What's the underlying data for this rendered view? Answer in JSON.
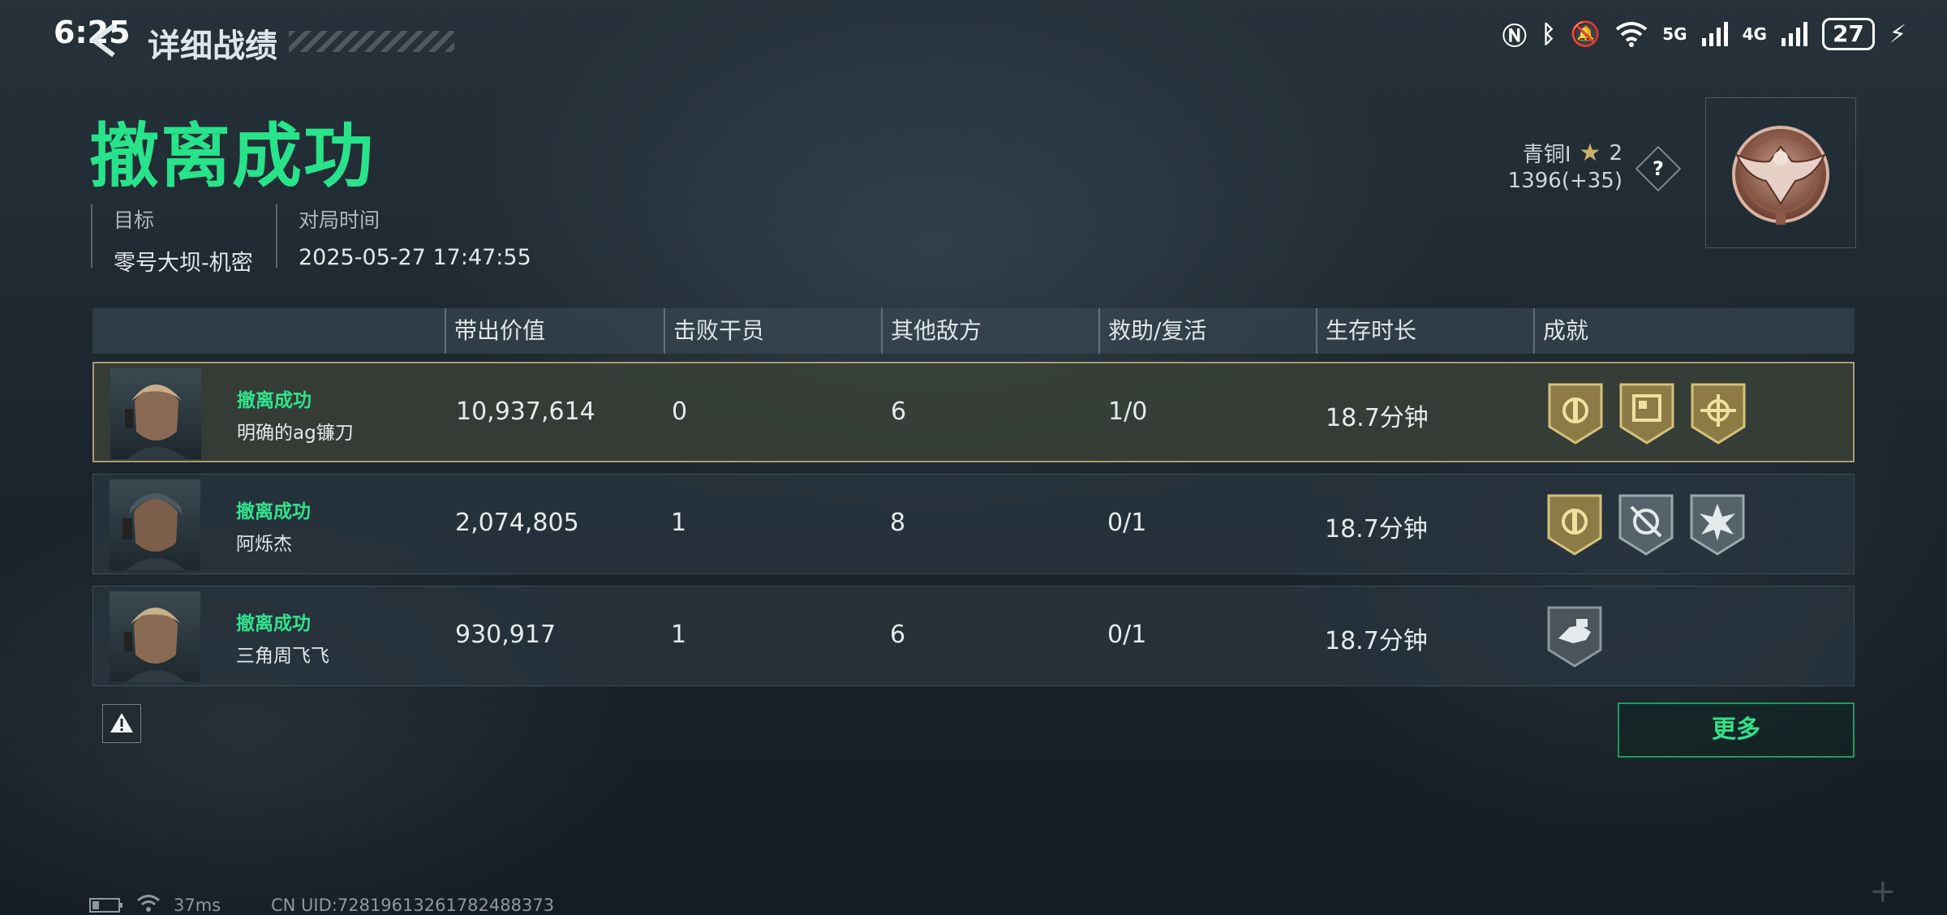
{
  "status_bar": {
    "time": "6:25",
    "network_5g": "5G",
    "network_4g": "4G",
    "battery": "27"
  },
  "header": {
    "title": "详细战绩"
  },
  "result": {
    "title": "撤离成功",
    "target_label": "目标",
    "target_value": "零号大坝-机密",
    "time_label": "对局时间",
    "time_value": "2025-05-27 17:47:55"
  },
  "rank": {
    "tier": "青铜I",
    "stars": "2",
    "score": "1396(+35)",
    "help": "?"
  },
  "table": {
    "columns": [
      "带出价值",
      "击败干员",
      "其他敌方",
      "救助/复活",
      "生存时长",
      "成就"
    ],
    "rows": [
      {
        "status": "撤离成功",
        "name": "明确的ag镰刀",
        "value": "10,937,614",
        "kills": "0",
        "other_enemies": "6",
        "assist_revive": "1/0",
        "survival": "18.7分钟",
        "badges": [
          "gold-shield-icon",
          "gold-board-icon",
          "gold-crosshair-icon"
        ]
      },
      {
        "status": "撤离成功",
        "name": "阿烁杰",
        "value": "2,074,805",
        "kills": "1",
        "other_enemies": "8",
        "assist_revive": "0/1",
        "survival": "18.7分钟",
        "badges": [
          "gold-shield-icon",
          "silver-target-icon",
          "silver-burst-icon"
        ]
      },
      {
        "status": "撤离成功",
        "name": "三角周飞飞",
        "value": "930,917",
        "kills": "1",
        "other_enemies": "6",
        "assist_revive": "0/1",
        "survival": "18.7分钟",
        "badges": [
          "silver-hand-icon"
        ]
      }
    ]
  },
  "more_button": "更多",
  "footer": {
    "ping": "37ms",
    "uid": "CN UID:7281961326178248837​3"
  }
}
